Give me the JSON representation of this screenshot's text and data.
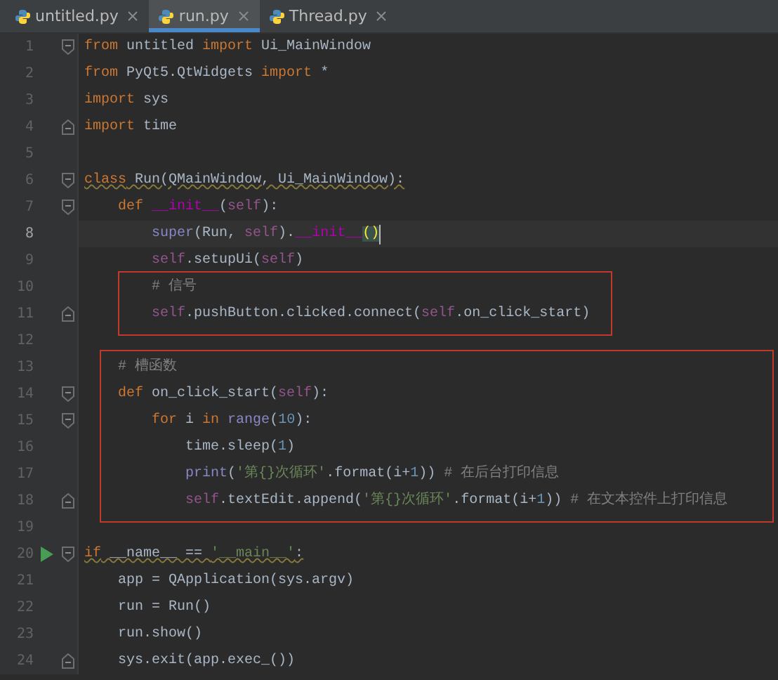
{
  "tabs": [
    {
      "label": "untitled.py",
      "selected": false
    },
    {
      "label": "run.py",
      "selected": true
    },
    {
      "label": "Thread.py",
      "selected": false
    }
  ],
  "blocks": [
    {
      "boxed": false,
      "lines": [
        {
          "number": "1",
          "fold_start": true,
          "fold_end": false,
          "current": false,
          "run": false,
          "warning": false,
          "tokens": [
            {
              "kind": "keyword",
              "text": "from"
            },
            {
              "kind": "plain",
              "text": " untitled "
            },
            {
              "kind": "keyword",
              "text": "import"
            },
            {
              "kind": "plain",
              "text": " Ui_MainWindow"
            }
          ]
        },
        {
          "number": "2",
          "fold_start": false,
          "fold_end": false,
          "current": false,
          "run": false,
          "warning": false,
          "tokens": [
            {
              "kind": "keyword",
              "text": "from"
            },
            {
              "kind": "plain",
              "text": " PyQt5.QtWidgets "
            },
            {
              "kind": "keyword",
              "text": "import"
            },
            {
              "kind": "plain",
              "text": " *"
            }
          ]
        },
        {
          "number": "3",
          "fold_start": false,
          "fold_end": false,
          "current": false,
          "run": false,
          "warning": false,
          "tokens": [
            {
              "kind": "keyword",
              "text": "import"
            },
            {
              "kind": "plain",
              "text": " sys"
            }
          ]
        },
        {
          "number": "4",
          "fold_start": false,
          "fold_end": true,
          "current": false,
          "run": false,
          "warning": false,
          "tokens": [
            {
              "kind": "keyword",
              "text": "import"
            },
            {
              "kind": "plain",
              "text": " time"
            }
          ]
        },
        {
          "number": "5",
          "fold_start": false,
          "fold_end": false,
          "current": false,
          "run": false,
          "warning": false
        },
        {
          "number": "6",
          "fold_start": true,
          "fold_end": false,
          "current": false,
          "run": false,
          "warning": true,
          "tokens": [
            {
              "kind": "keyword",
              "text": "class"
            },
            {
              "kind": "plain",
              "text": " Run(QMainWindow, Ui_MainWindow):"
            }
          ]
        },
        {
          "number": "7",
          "fold_start": true,
          "fold_end": false,
          "current": false,
          "run": false,
          "warning": false,
          "tokens": [
            {
              "kind": "keyword",
              "text": "    def"
            },
            {
              "kind": "magic",
              "text": " __init__"
            },
            {
              "kind": "plain",
              "text": "("
            },
            {
              "kind": "self",
              "text": "self"
            },
            {
              "kind": "plain",
              "text": "):"
            }
          ]
        },
        {
          "number": "8",
          "fold_start": false,
          "fold_end": false,
          "current": true,
          "run": false,
          "warning": false,
          "tokens": [
            {
              "kind": "builtin",
              "text": "        super"
            },
            {
              "kind": "plain",
              "text": "(Run, "
            },
            {
              "kind": "self",
              "text": "self"
            },
            {
              "kind": "plain",
              "text": ")."
            },
            {
              "kind": "magic",
              "text": "__init__"
            },
            {
              "kind": "brace",
              "text": "()"
            }
          ]
        },
        {
          "number": "9",
          "fold_start": false,
          "fold_end": false,
          "current": false,
          "run": false,
          "warning": false,
          "tokens": [
            {
              "kind": "self",
              "text": "        self"
            },
            {
              "kind": "plain",
              "text": ".setupUi("
            },
            {
              "kind": "self",
              "text": "self"
            },
            {
              "kind": "plain",
              "text": ")"
            }
          ]
        }
      ]
    },
    {
      "boxed": true,
      "lines": [
        {
          "number": "10",
          "fold_start": false,
          "fold_end": false,
          "current": false,
          "run": false,
          "warning": false,
          "tokens": [
            {
              "kind": "comment",
              "text": "        # 信号"
            }
          ]
        },
        {
          "number": "11",
          "fold_start": false,
          "fold_end": true,
          "current": false,
          "run": false,
          "warning": false,
          "tokens": [
            {
              "kind": "self",
              "text": "        self"
            },
            {
              "kind": "plain",
              "text": ".pushButton.clicked.connect("
            },
            {
              "kind": "self",
              "text": "self"
            },
            {
              "kind": "plain",
              "text": ".on_click_start)"
            }
          ]
        }
      ]
    },
    {
      "boxed": false,
      "lines": [
        {
          "number": "12",
          "fold_start": false,
          "fold_end": false,
          "current": false,
          "run": false,
          "warning": false
        }
      ]
    },
    {
      "boxed": true,
      "lines": [
        {
          "number": "13",
          "fold_start": false,
          "fold_end": false,
          "current": false,
          "run": false,
          "warning": false,
          "tokens": [
            {
              "kind": "comment",
              "text": "    # 槽函数"
            }
          ]
        },
        {
          "number": "14",
          "fold_start": true,
          "fold_end": false,
          "current": false,
          "run": false,
          "warning": false,
          "tokens": [
            {
              "kind": "keyword",
              "text": "    def"
            },
            {
              "kind": "plain",
              "text": " on_click_start("
            },
            {
              "kind": "self",
              "text": "self"
            },
            {
              "kind": "plain",
              "text": "):"
            }
          ]
        },
        {
          "number": "15",
          "fold_start": true,
          "fold_end": false,
          "current": false,
          "run": false,
          "warning": false,
          "tokens": [
            {
              "kind": "keyword",
              "text": "        for"
            },
            {
              "kind": "plain",
              "text": " i "
            },
            {
              "kind": "keyword",
              "text": "in"
            },
            {
              "kind": "builtin",
              "text": " range"
            },
            {
              "kind": "plain",
              "text": "("
            },
            {
              "kind": "number",
              "text": "10"
            },
            {
              "kind": "plain",
              "text": "):"
            }
          ]
        },
        {
          "number": "16",
          "fold_start": false,
          "fold_end": false,
          "current": false,
          "run": false,
          "warning": false,
          "tokens": [
            {
              "kind": "plain",
              "text": "            time.sleep("
            },
            {
              "kind": "number",
              "text": "1"
            },
            {
              "kind": "plain",
              "text": ")"
            }
          ]
        },
        {
          "number": "17",
          "fold_start": false,
          "fold_end": false,
          "current": false,
          "run": false,
          "warning": false,
          "tokens": [
            {
              "kind": "builtin",
              "text": "            print"
            },
            {
              "kind": "plain",
              "text": "("
            },
            {
              "kind": "string",
              "text": "'第{}次循环'"
            },
            {
              "kind": "plain",
              "text": ".format(i+"
            },
            {
              "kind": "number",
              "text": "1"
            },
            {
              "kind": "plain",
              "text": ")) "
            },
            {
              "kind": "comment",
              "text": "# 在后台打印信息"
            }
          ]
        },
        {
          "number": "18",
          "fold_start": false,
          "fold_end": true,
          "current": false,
          "run": false,
          "warning": false,
          "tokens": [
            {
              "kind": "self",
              "text": "            self"
            },
            {
              "kind": "plain",
              "text": ".textEdit.append("
            },
            {
              "kind": "string",
              "text": "'第{}次循环'"
            },
            {
              "kind": "plain",
              "text": ".format(i+"
            },
            {
              "kind": "number",
              "text": "1"
            },
            {
              "kind": "plain",
              "text": ")) "
            },
            {
              "kind": "comment",
              "text": "# 在文本控件上打印信息"
            }
          ]
        }
      ]
    },
    {
      "boxed": false,
      "lines": [
        {
          "number": "19",
          "fold_start": false,
          "fold_end": false,
          "current": false,
          "run": false,
          "warning": false
        },
        {
          "number": "20",
          "fold_start": true,
          "fold_end": false,
          "current": false,
          "run": true,
          "warning": true,
          "tokens": [
            {
              "kind": "keyword",
              "text": "if"
            },
            {
              "kind": "plain",
              "text": " __name__ == "
            },
            {
              "kind": "string",
              "text": "'__main__'"
            },
            {
              "kind": "plain",
              "text": ":"
            }
          ]
        },
        {
          "number": "21",
          "fold_start": false,
          "fold_end": false,
          "current": false,
          "run": false,
          "warning": false,
          "tokens": [
            {
              "kind": "plain",
              "text": "    app = QApplication(sys.argv)"
            }
          ]
        },
        {
          "number": "22",
          "fold_start": false,
          "fold_end": false,
          "current": false,
          "run": false,
          "warning": false,
          "tokens": [
            {
              "kind": "plain",
              "text": "    run = Run()"
            }
          ]
        },
        {
          "number": "23",
          "fold_start": false,
          "fold_end": false,
          "current": false,
          "run": false,
          "warning": false,
          "tokens": [
            {
              "kind": "plain",
              "text": "    run.show()"
            }
          ]
        },
        {
          "number": "24",
          "fold_start": false,
          "fold_end": true,
          "current": false,
          "run": false,
          "warning": false,
          "tokens": [
            {
              "kind": "plain",
              "text": "    sys.exit(app.exec_())"
            }
          ]
        }
      ]
    }
  ]
}
